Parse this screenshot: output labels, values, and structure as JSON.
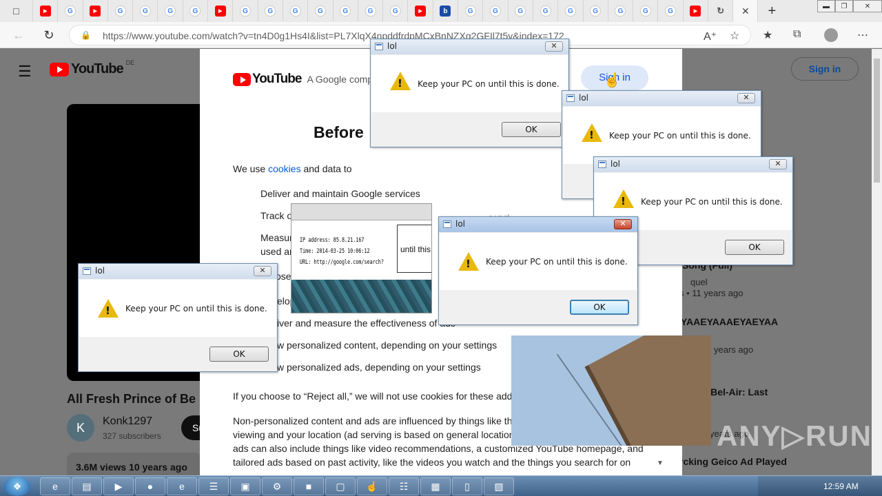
{
  "browser": {
    "tabs": [
      {
        "icon": "youtube-favicon"
      },
      {
        "icon": "google-favicon"
      },
      {
        "icon": "youtube-favicon"
      },
      {
        "icon": "google-favicon"
      },
      {
        "icon": "google-favicon"
      },
      {
        "icon": "google-favicon"
      },
      {
        "icon": "google-favicon"
      },
      {
        "icon": "youtube-favicon"
      },
      {
        "icon": "google-favicon"
      },
      {
        "icon": "google-favicon"
      },
      {
        "icon": "google-favicon"
      },
      {
        "icon": "google-favicon"
      },
      {
        "icon": "google-favicon"
      },
      {
        "icon": "google-favicon"
      },
      {
        "icon": "google-favicon"
      },
      {
        "icon": "youtube-favicon"
      },
      {
        "icon": "bing-favicon"
      },
      {
        "icon": "google-favicon"
      },
      {
        "icon": "google-favicon"
      },
      {
        "icon": "google-favicon"
      },
      {
        "icon": "google-favicon"
      },
      {
        "icon": "google-favicon"
      },
      {
        "icon": "google-favicon"
      },
      {
        "icon": "google-favicon"
      },
      {
        "icon": "google-favicon"
      },
      {
        "icon": "google-favicon"
      },
      {
        "icon": "youtube-favicon"
      },
      {
        "icon": "loading-icon"
      }
    ],
    "url": "https://www.youtube.com/watch?v=tn4D0g1Hs4I&list=PL7XlqX4npddfrdpMCxBnNZXg2GFIl7t5v&index=172"
  },
  "youtube": {
    "logo_text": "YouTube",
    "country": "DE",
    "signin": "Sign in",
    "video_title": "All Fresh Prince of Be",
    "channel_initial": "K",
    "channel_name": "Konk1297",
    "subscribers": "327 subscribers",
    "subscribe_partial": "Su",
    "views": "3.6M views  10 years ago",
    "sidebar": [
      {
        "kind": "title",
        "text": "Song (Full)"
      },
      {
        "kind": "text",
        "text": "quel"
      },
      {
        "kind": "text",
        "text": "s • 11 years ago"
      },
      {
        "kind": "title",
        "text": "YAAEYAAAEYAEYAA"
      },
      {
        "kind": "text",
        "text": "years ago"
      },
      {
        "kind": "title",
        "text": "of Bel-Air: Last"
      },
      {
        "kind": "text",
        "text": "years ago"
      },
      {
        "kind": "title",
        "text": "rcking Geico Ad Played"
      }
    ]
  },
  "consent": {
    "logo_text": "YouTube",
    "tagline": "A Google compa",
    "signin": "Sign in",
    "heading": "Before",
    "intro_pre": "We use ",
    "intro_link": "cookies",
    "intro_post": " and data to",
    "items": [
      "Deliver and maintain Google services",
      "Track o",
      "Measur",
      "used ar",
      "ose",
      "elop",
      "iver and measure the effectiveness of ads",
      "w personalized content, depending on your settings",
      "w personalized ads, depending on your settings"
    ],
    "partial_word": "spse",
    "reject_text": "If you choose to “Reject all,” we will not use cookies for these additi",
    "para2_line1": "Non-personalized content and ads are influenced by things like the",
    "para2_line2": "viewing and your location (ad serving is based on general location",
    "para2_line3": "ads can also include things like video recommendations, a customized YouTube homepage, and",
    "para2_line4": "tailored ads based on past activity, like the videos you watch and the things you search for on"
  },
  "artifact": {
    "line1": "IP address: 85.8.21.167",
    "line2": "Time: 2014-03-25 10:06:12",
    "line3": "URL: http://google.com/search?",
    "box_text": "until this"
  },
  "dialogs": [
    {
      "caption": "lol",
      "message": "Keep your PC on until this is done.",
      "ok": "OK"
    },
    {
      "caption": "lol",
      "message": "Keep your PC on until this is done.",
      "ok": "OK"
    },
    {
      "caption": "lol",
      "message": "Keep your PC on until this is done.",
      "ok": "OK"
    },
    {
      "caption": "lol",
      "message": "Keep your PC on until this is done.",
      "ok": "OK"
    },
    {
      "caption": "lol",
      "message": "Keep your PC on until this is done.",
      "ok": "OK"
    }
  ],
  "taskbar": {
    "clock": "12:59 AM",
    "buttons": [
      {
        "icon": "ie-icon"
      },
      {
        "icon": "folder-icon"
      },
      {
        "icon": "media-player-icon"
      },
      {
        "icon": "chrome-icon"
      },
      {
        "icon": "edge-icon"
      },
      {
        "icon": "notepad-icon"
      },
      {
        "icon": "terminal-icon"
      },
      {
        "icon": "app-icon"
      },
      {
        "icon": "briefcase-icon"
      },
      {
        "icon": "monitor-icon"
      },
      {
        "icon": "hand-icon"
      },
      {
        "icon": "document-icon"
      },
      {
        "icon": "calculator-icon"
      },
      {
        "icon": "file-icon"
      },
      {
        "icon": "archive-icon"
      }
    ]
  },
  "watermark": "ANY▷RUN"
}
